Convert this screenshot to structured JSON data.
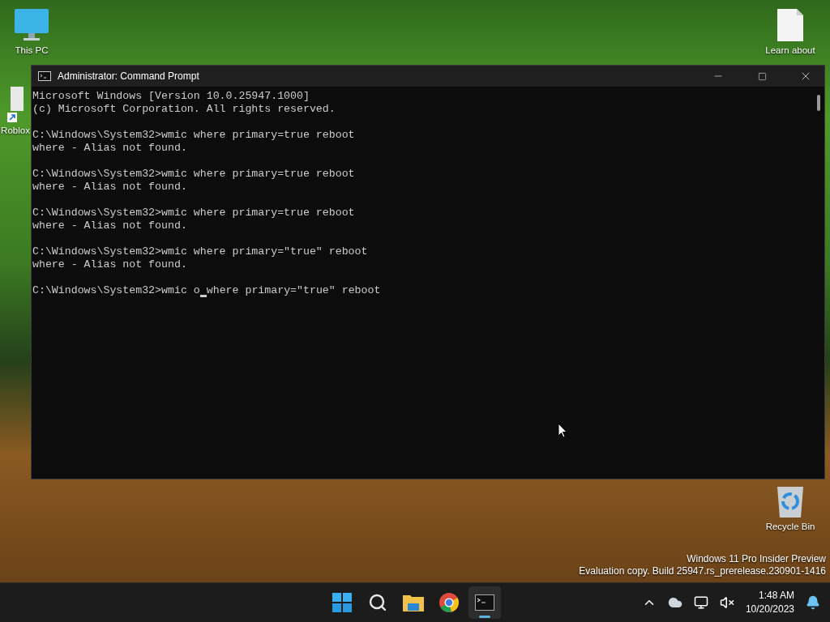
{
  "desktop": {
    "icons": [
      {
        "label": "This PC",
        "kind": "pc"
      },
      {
        "label": "Roblox",
        "kind": "shortcut"
      },
      {
        "label": "Learn about",
        "kind": "document"
      },
      {
        "label": "Recycle Bin",
        "kind": "bin"
      }
    ]
  },
  "window": {
    "title": "Administrator: Command Prompt",
    "blocks": [
      [
        "Microsoft Windows [Version 10.0.25947.1000]",
        "(c) Microsoft Corporation. All rights reserved."
      ],
      [
        "C:\\Windows\\System32>wmic where primary=true reboot",
        "where - Alias not found."
      ],
      [
        "C:\\Windows\\System32>wmic where primary=true reboot",
        "where - Alias not found."
      ],
      [
        "C:\\Windows\\System32>wmic where primary=true reboot",
        "where - Alias not found."
      ],
      [
        "C:\\Windows\\System32>wmic where primary=\"true\" reboot",
        "where - Alias not found."
      ]
    ],
    "prompt": {
      "before_cursor": "C:\\Windows\\System32>wmic o",
      "after_cursor": "where primary=\"true\" reboot"
    }
  },
  "build_info": [
    "Windows 11 Pro Insider Preview",
    "Evaluation copy. Build 25947.rs_prerelease.230901-1416"
  ],
  "taskbar": {
    "apps": [
      {
        "kind": "start",
        "selected": false
      },
      {
        "kind": "search",
        "selected": false
      },
      {
        "kind": "explorer",
        "selected": false
      },
      {
        "kind": "browser",
        "selected": false
      },
      {
        "kind": "terminal",
        "selected": true
      }
    ],
    "time": "1:48 AM",
    "date": "10/20/2023"
  }
}
